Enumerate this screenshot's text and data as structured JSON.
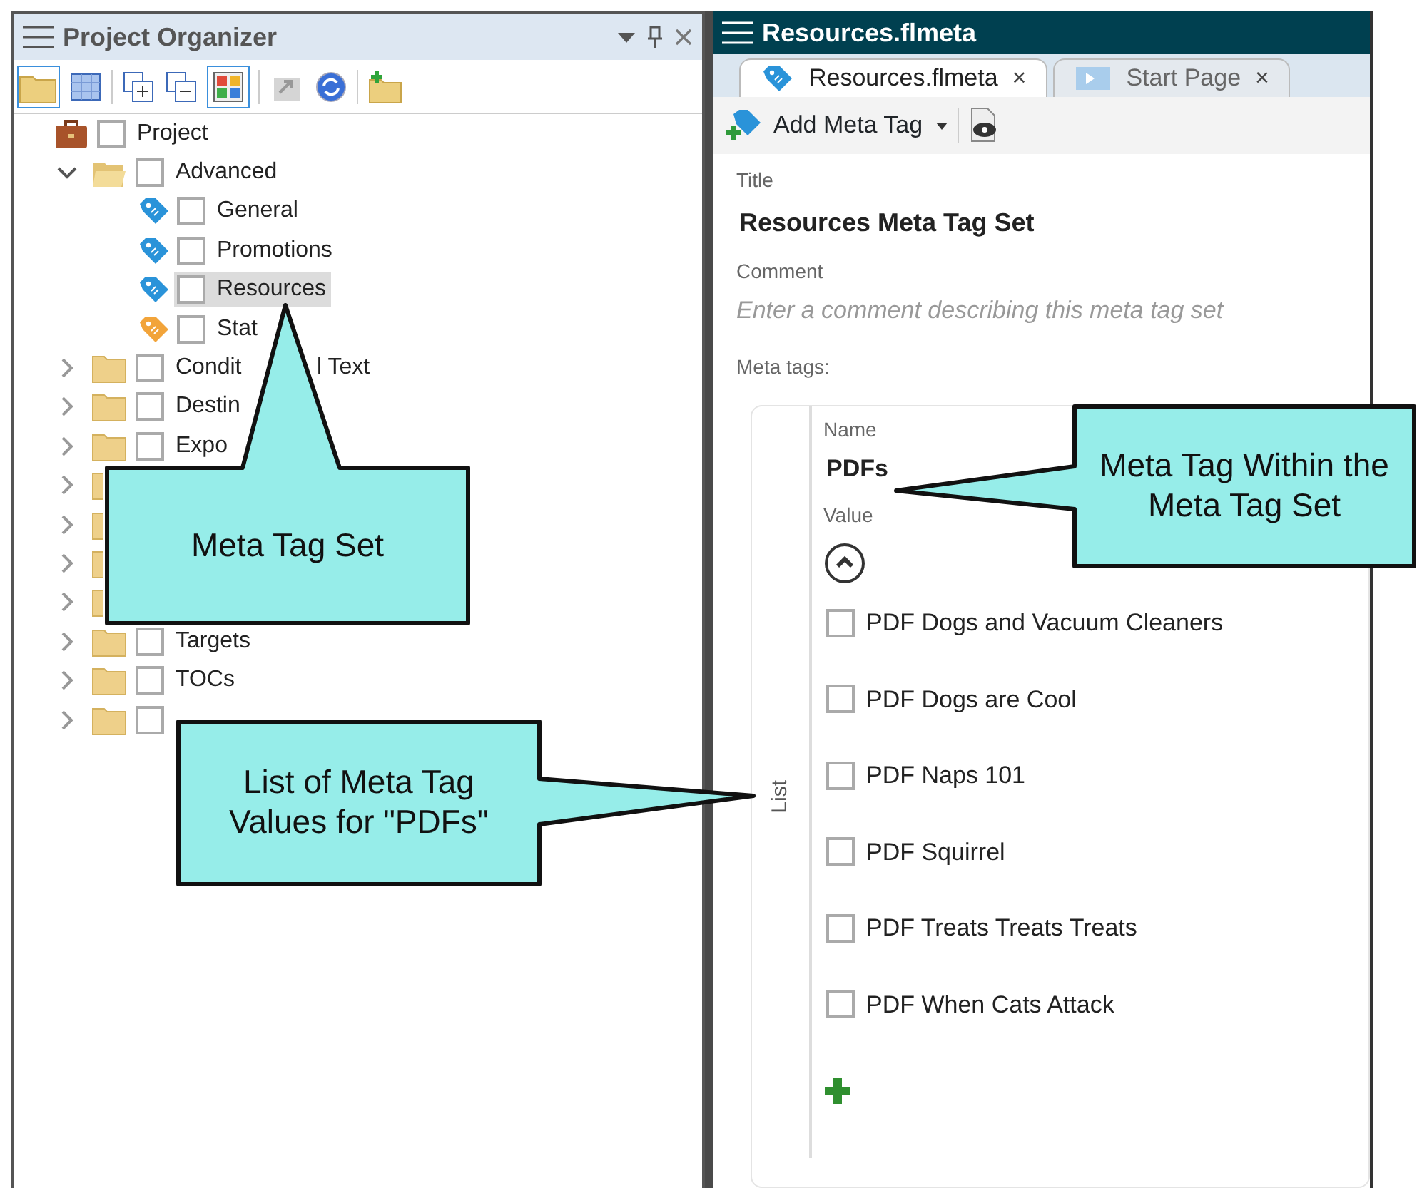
{
  "organizer": {
    "title": "Project Organizer",
    "tree": [
      {
        "label": "Project",
        "kind": "project",
        "checked": false,
        "selected": false,
        "children": [
          {
            "label": "Advanced",
            "kind": "folder",
            "checked": false,
            "selected": false,
            "expanded": true,
            "children": [
              {
                "label": "General",
                "kind": "tag",
                "color": "#2a93d9",
                "checked": false,
                "selected": false
              },
              {
                "label": "Promotions",
                "kind": "tag",
                "color": "#2a93d9",
                "checked": false,
                "selected": false
              },
              {
                "label": "Resources",
                "kind": "tag",
                "color": "#2a93d9",
                "checked": false,
                "selected": true
              },
              {
                "label": "Stat",
                "kind": "tag",
                "color": "#f2a43a",
                "checked": false,
                "selected": false
              }
            ]
          },
          {
            "label": "Condit",
            "tail": "l Text",
            "kind": "folder",
            "checked": false,
            "selected": false,
            "expanded": false
          },
          {
            "label": "Destin",
            "kind": "folder",
            "checked": false,
            "selected": false,
            "expanded": false
          },
          {
            "label": "Expo",
            "kind": "folder",
            "checked": false,
            "selected": false,
            "expanded": false
          },
          {
            "kind": "folder",
            "expanded": false
          },
          {
            "kind": "folder",
            "expanded": false
          },
          {
            "kind": "folder",
            "expanded": false
          },
          {
            "kind": "folder",
            "expanded": false
          },
          {
            "label": "Targets",
            "kind": "folder",
            "checked": false,
            "selected": false,
            "expanded": false
          },
          {
            "label": "TOCs",
            "kind": "folder",
            "checked": false,
            "selected": false,
            "expanded": false
          },
          {
            "kind": "folder",
            "checked": false,
            "expanded": false
          }
        ]
      }
    ]
  },
  "editor": {
    "title": "Resources.flmeta",
    "tabs": [
      {
        "label": "Resources.flmeta",
        "close": "×",
        "selected": true
      },
      {
        "label": "Start Page",
        "close": "×",
        "selected": false
      }
    ],
    "toolbar": {
      "add_button": "Add Meta Tag"
    },
    "title_label": "Title",
    "title_value": "Resources Meta Tag Set",
    "comment_label": "Comment",
    "comment_placeholder": "Enter a comment describing this meta tag set",
    "meta_tags_label": "Meta tags:",
    "meta_tag": {
      "side_label": "List",
      "name_label": "Name",
      "name": "PDFs",
      "value_label": "Value",
      "values": [
        {
          "label": "PDF Dogs and Vacuum Cleaners",
          "checked": false
        },
        {
          "label": "PDF Dogs are Cool",
          "checked": false
        },
        {
          "label": "PDF Naps 101",
          "checked": false
        },
        {
          "label": "PDF Squirrel",
          "checked": false
        },
        {
          "label": "PDF Treats Treats Treats",
          "checked": false
        },
        {
          "label": "PDF When Cats Attack",
          "checked": false
        }
      ]
    }
  },
  "callouts": [
    {
      "text": "Meta Tag Set"
    },
    {
      "text": "List of Meta Tag Values for \"PDFs\""
    },
    {
      "text": "Meta Tag Within the Meta Tag Set"
    }
  ]
}
